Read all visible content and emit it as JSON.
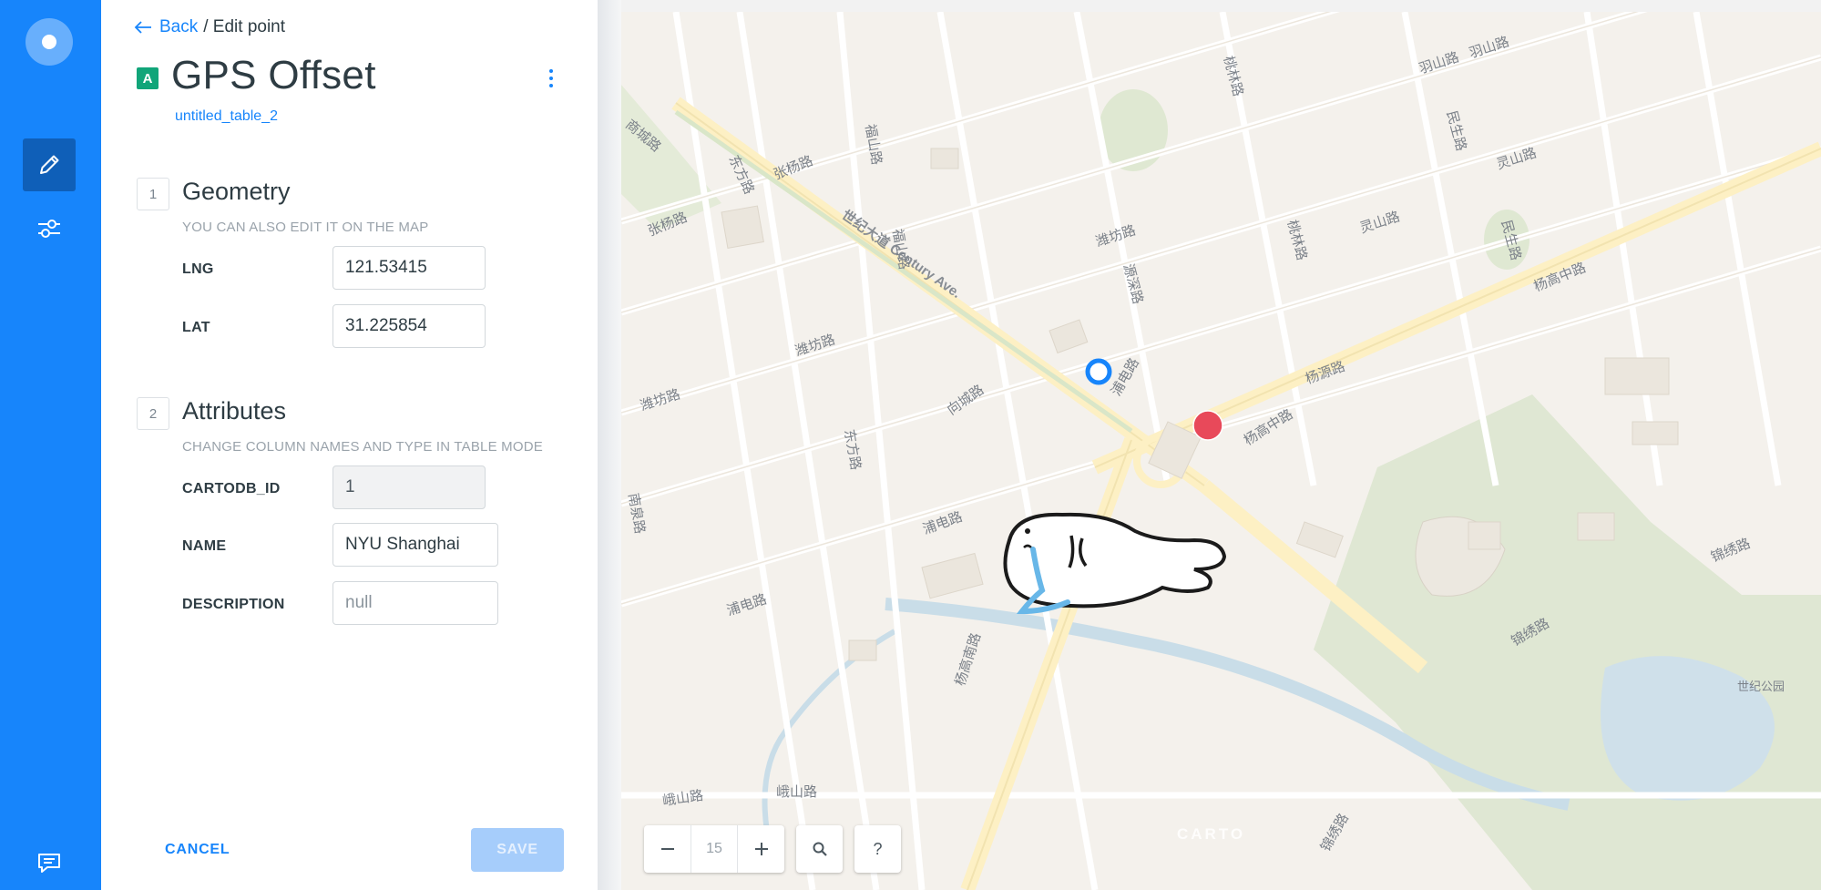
{
  "breadcrumb": {
    "back": "Back",
    "current": "/ Edit point"
  },
  "layer": {
    "badge": "A",
    "title": "GPS Offset",
    "table": "untitled_table_2"
  },
  "geometry": {
    "number": "1",
    "title": "Geometry",
    "hint": "YOU CAN ALSO EDIT IT ON THE MAP",
    "lng_label": "LNG",
    "lng_value": "121.53415",
    "lat_label": "LAT",
    "lat_value": "31.225854"
  },
  "attributes": {
    "number": "2",
    "title": "Attributes",
    "hint": "CHANGE COLUMN NAMES AND TYPE IN TABLE MODE",
    "fields": [
      {
        "label": "CARTODB_ID",
        "value": "1"
      },
      {
        "label": "NAME",
        "value": "NYU Shanghai"
      },
      {
        "label": "DESCRIPTION",
        "value": "null"
      }
    ]
  },
  "actions": {
    "cancel": "CANCEL",
    "save": "SAVE"
  },
  "map": {
    "zoom": "15",
    "help": "?",
    "attribution": "CARTO",
    "labels": {
      "century_ave": "世纪大道 Century Ave.",
      "yanggao_mid": "杨高中路",
      "yanggao_mid_2": "杨高中路",
      "yanggao_south": "杨高南路",
      "weifang_1": "潍坊路",
      "weifang_2": "潍坊路",
      "weifang_3": "潍坊路",
      "dongfang_1": "东方路",
      "dongfang_2": "东方路",
      "zhangyang_1": "张杨路",
      "zhangyang_2": "张杨路",
      "pudian_1": "浦电路",
      "pudian_2": "浦电路",
      "pudian_3": "浦电路",
      "jinxiu_1": "锦绣路",
      "jinxiu_2": "锦绣路",
      "jinxiu_3": "锦绣路",
      "emei": "峨山路",
      "emei_2": "峨山路",
      "yangyuan": "杨源路",
      "xiangcheng": "向城路",
      "yuanshen": "源深路",
      "taolin_1": "桃林路",
      "taolin_2": "桃林路",
      "lingshan": "灵山路",
      "lingshan_2": "灵山路",
      "minsheng_1": "民生路",
      "minsheng_2": "民生路",
      "fushan_1": "福山路",
      "fushan_2": "福山路",
      "shangcheng": "商城路",
      "yushan": "羽山路",
      "yushan_2": "羽山路",
      "nanquan": "南泉路",
      "century_park": "世纪公园"
    }
  },
  "colors": {
    "rail": "#1785fb",
    "rail_active": "#0f5fb8",
    "accent": "#1785fb",
    "badge": "#11a579",
    "marker": "#e8495a",
    "original_point": "#1785fb",
    "save_disabled": "#a6cdfb"
  },
  "icons": {
    "rail_logo": "logo-icon",
    "rail_edit": "pencil-icon",
    "rail_filters": "sliders-icon",
    "rail_feedback": "chat-icon",
    "back": "arrow-left-icon",
    "options": "kebab-icon",
    "zoom_out": "minus-icon",
    "zoom_in": "plus-icon",
    "search": "search-icon"
  }
}
